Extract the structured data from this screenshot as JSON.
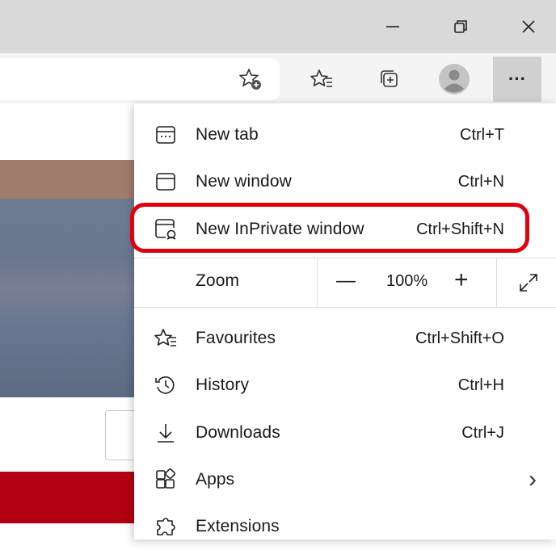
{
  "window": {
    "minimize_icon": "minimize-icon",
    "restore_icon": "restore-icon",
    "close_icon": "close-icon"
  },
  "toolbar": {
    "icons": [
      "add-favorite-icon",
      "favorites-icon",
      "collections-icon",
      "profile-avatar",
      "more-icon"
    ],
    "more_label": "···"
  },
  "menu": {
    "items": [
      {
        "label": "New tab",
        "shortcut": "Ctrl+T",
        "icon": "new-tab-icon"
      },
      {
        "label": "New window",
        "shortcut": "Ctrl+N",
        "icon": "new-window-icon"
      },
      {
        "label": "New InPrivate window",
        "shortcut": "Ctrl+Shift+N",
        "icon": "inprivate-icon"
      }
    ],
    "zoom": {
      "label": "Zoom",
      "minus": "—",
      "value": "100%",
      "plus": "+",
      "fullscreen_icon": "fullscreen-icon"
    },
    "items2": [
      {
        "label": "Favourites",
        "shortcut": "Ctrl+Shift+O",
        "icon": "favourites-icon"
      },
      {
        "label": "History",
        "shortcut": "Ctrl+H",
        "icon": "history-icon"
      },
      {
        "label": "Downloads",
        "shortcut": "Ctrl+J",
        "icon": "downloads-icon"
      },
      {
        "label": "Apps",
        "shortcut": "",
        "icon": "apps-icon",
        "submenu": "›"
      },
      {
        "label": "Extensions",
        "shortcut": "",
        "icon": "extensions-icon"
      }
    ]
  },
  "colors": {
    "highlight": "#e0000e",
    "more_button_bg": "#d0d0d0",
    "page_red": "#b00012"
  }
}
